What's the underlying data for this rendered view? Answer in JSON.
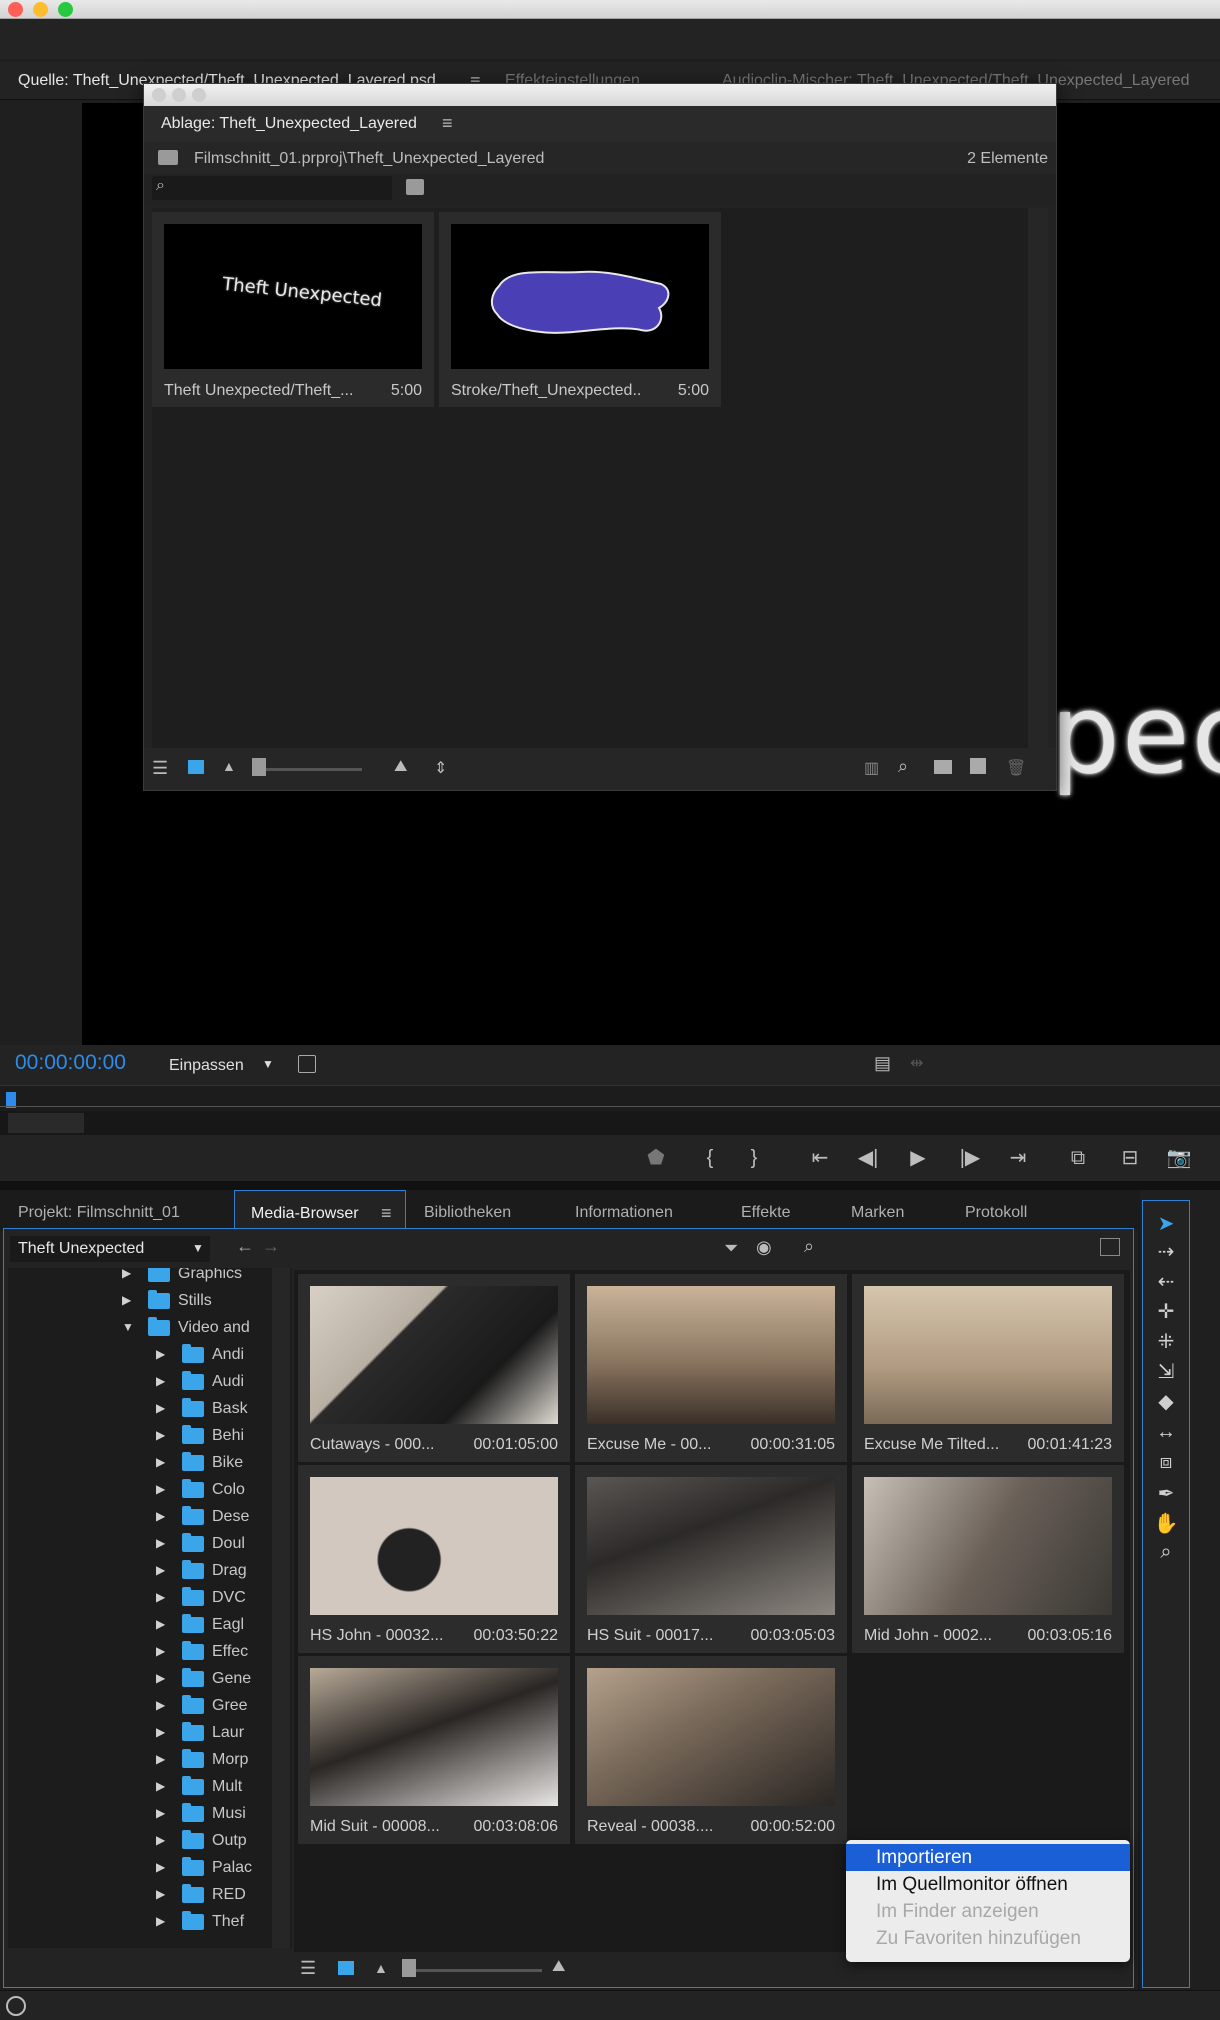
{
  "window": {
    "traffic_colors": {
      "close": "#fe5f57",
      "minimize": "#febc2e",
      "zoom": "#28c840"
    }
  },
  "source_monitor": {
    "tabs": [
      {
        "label": "Quelle: Theft_Unexpected/Theft_Unexpected_Layered.psd"
      },
      {
        "label": "Effekteinstellungen"
      },
      {
        "label": "Audioclip-Mischer: Theft_Unexpected/Theft_Unexpected_Layered"
      }
    ],
    "menu_icon": "hamburger-icon",
    "preview_text": "pec",
    "timecode": "00:00:00:00",
    "fit_label": "Einpassen",
    "accent": "#2d8ceb"
  },
  "bin": {
    "title": "Ablage: Theft_Unexpected_Layered",
    "path": "Filmschnitt_01.prproj\\Theft_Unexpected_Layered",
    "count": "2 Elemente",
    "items": [
      {
        "name": "Theft Unexpected/Theft_...",
        "duration": "5:00",
        "thumb_text": "Theft Unexpected"
      },
      {
        "name": "Stroke/Theft_Unexpected...",
        "duration": "5:00"
      }
    ]
  },
  "media_browser": {
    "tabs": [
      {
        "label": "Projekt: Filmschnitt_01"
      },
      {
        "label": "Media-Browser"
      },
      {
        "label": "Bibliotheken"
      },
      {
        "label": "Informationen"
      },
      {
        "label": "Effekte"
      },
      {
        "label": "Marken"
      },
      {
        "label": "Protokoll"
      }
    ],
    "active_tab": "Media-Browser",
    "location": "Theft Unexpected",
    "tree": [
      {
        "label": "Graphics",
        "level": 1,
        "expanded": false
      },
      {
        "label": "Stills",
        "level": 1,
        "expanded": false
      },
      {
        "label": "Video and",
        "level": 1,
        "expanded": true
      },
      {
        "label": "Andi",
        "level": 2
      },
      {
        "label": "Audi",
        "level": 2
      },
      {
        "label": "Bask",
        "level": 2
      },
      {
        "label": "Behi",
        "level": 2
      },
      {
        "label": "Bike",
        "level": 2
      },
      {
        "label": "Colo",
        "level": 2
      },
      {
        "label": "Dese",
        "level": 2
      },
      {
        "label": "Doul",
        "level": 2
      },
      {
        "label": "Drag",
        "level": 2
      },
      {
        "label": "DVC",
        "level": 2
      },
      {
        "label": "Eagl",
        "level": 2
      },
      {
        "label": "Effec",
        "level": 2
      },
      {
        "label": "Gene",
        "level": 2
      },
      {
        "label": "Gree",
        "level": 2
      },
      {
        "label": "Laur",
        "level": 2
      },
      {
        "label": "Morp",
        "level": 2
      },
      {
        "label": "Mult",
        "level": 2
      },
      {
        "label": "Musi",
        "level": 2
      },
      {
        "label": "Outp",
        "level": 2
      },
      {
        "label": "Palac",
        "level": 2
      },
      {
        "label": "RED",
        "level": 2
      },
      {
        "label": "Thef",
        "level": 2
      }
    ],
    "clips": [
      {
        "name": "Cutaways - 000...",
        "duration": "00:01:05:00"
      },
      {
        "name": "Excuse Me - 00...",
        "duration": "00:00:31:05"
      },
      {
        "name": "Excuse Me Tilted...",
        "duration": "00:01:41:23"
      },
      {
        "name": "HS John - 00032...",
        "duration": "00:03:50:22"
      },
      {
        "name": "HS Suit - 00017...",
        "duration": "00:03:05:03"
      },
      {
        "name": "Mid John - 0002...",
        "duration": "00:03:05:16"
      },
      {
        "name": "Mid Suit - 00008...",
        "duration": "00:03:08:06"
      },
      {
        "name": "Reveal - 00038....",
        "duration": "00:00:52:00"
      }
    ]
  },
  "context_menu": {
    "items": [
      {
        "label": "Importieren",
        "enabled": true,
        "highlighted": true
      },
      {
        "label": "Im Quellmonitor öffnen",
        "enabled": true
      },
      {
        "label": "Im Finder anzeigen",
        "enabled": false
      },
      {
        "label": "Zu Favoriten hinzufügen",
        "enabled": false
      }
    ],
    "highlight": "#1a5fd6"
  }
}
